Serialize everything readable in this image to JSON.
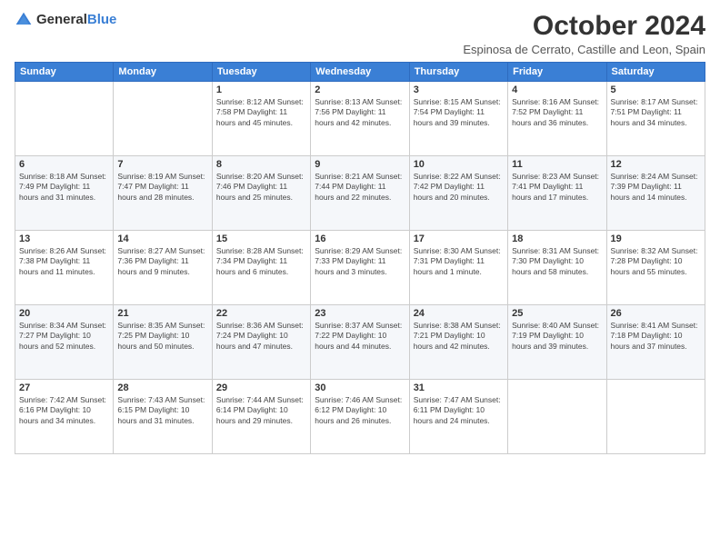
{
  "header": {
    "logo_general": "General",
    "logo_blue": "Blue",
    "title": "October 2024",
    "subtitle": "Espinosa de Cerrato, Castille and Leon, Spain"
  },
  "weekdays": [
    "Sunday",
    "Monday",
    "Tuesday",
    "Wednesday",
    "Thursday",
    "Friday",
    "Saturday"
  ],
  "weeks": [
    [
      {
        "day": "",
        "info": ""
      },
      {
        "day": "",
        "info": ""
      },
      {
        "day": "1",
        "info": "Sunrise: 8:12 AM\nSunset: 7:58 PM\nDaylight: 11 hours and 45 minutes."
      },
      {
        "day": "2",
        "info": "Sunrise: 8:13 AM\nSunset: 7:56 PM\nDaylight: 11 hours and 42 minutes."
      },
      {
        "day": "3",
        "info": "Sunrise: 8:15 AM\nSunset: 7:54 PM\nDaylight: 11 hours and 39 minutes."
      },
      {
        "day": "4",
        "info": "Sunrise: 8:16 AM\nSunset: 7:52 PM\nDaylight: 11 hours and 36 minutes."
      },
      {
        "day": "5",
        "info": "Sunrise: 8:17 AM\nSunset: 7:51 PM\nDaylight: 11 hours and 34 minutes."
      }
    ],
    [
      {
        "day": "6",
        "info": "Sunrise: 8:18 AM\nSunset: 7:49 PM\nDaylight: 11 hours and 31 minutes."
      },
      {
        "day": "7",
        "info": "Sunrise: 8:19 AM\nSunset: 7:47 PM\nDaylight: 11 hours and 28 minutes."
      },
      {
        "day": "8",
        "info": "Sunrise: 8:20 AM\nSunset: 7:46 PM\nDaylight: 11 hours and 25 minutes."
      },
      {
        "day": "9",
        "info": "Sunrise: 8:21 AM\nSunset: 7:44 PM\nDaylight: 11 hours and 22 minutes."
      },
      {
        "day": "10",
        "info": "Sunrise: 8:22 AM\nSunset: 7:42 PM\nDaylight: 11 hours and 20 minutes."
      },
      {
        "day": "11",
        "info": "Sunrise: 8:23 AM\nSunset: 7:41 PM\nDaylight: 11 hours and 17 minutes."
      },
      {
        "day": "12",
        "info": "Sunrise: 8:24 AM\nSunset: 7:39 PM\nDaylight: 11 hours and 14 minutes."
      }
    ],
    [
      {
        "day": "13",
        "info": "Sunrise: 8:26 AM\nSunset: 7:38 PM\nDaylight: 11 hours and 11 minutes."
      },
      {
        "day": "14",
        "info": "Sunrise: 8:27 AM\nSunset: 7:36 PM\nDaylight: 11 hours and 9 minutes."
      },
      {
        "day": "15",
        "info": "Sunrise: 8:28 AM\nSunset: 7:34 PM\nDaylight: 11 hours and 6 minutes."
      },
      {
        "day": "16",
        "info": "Sunrise: 8:29 AM\nSunset: 7:33 PM\nDaylight: 11 hours and 3 minutes."
      },
      {
        "day": "17",
        "info": "Sunrise: 8:30 AM\nSunset: 7:31 PM\nDaylight: 11 hours and 1 minute."
      },
      {
        "day": "18",
        "info": "Sunrise: 8:31 AM\nSunset: 7:30 PM\nDaylight: 10 hours and 58 minutes."
      },
      {
        "day": "19",
        "info": "Sunrise: 8:32 AM\nSunset: 7:28 PM\nDaylight: 10 hours and 55 minutes."
      }
    ],
    [
      {
        "day": "20",
        "info": "Sunrise: 8:34 AM\nSunset: 7:27 PM\nDaylight: 10 hours and 52 minutes."
      },
      {
        "day": "21",
        "info": "Sunrise: 8:35 AM\nSunset: 7:25 PM\nDaylight: 10 hours and 50 minutes."
      },
      {
        "day": "22",
        "info": "Sunrise: 8:36 AM\nSunset: 7:24 PM\nDaylight: 10 hours and 47 minutes."
      },
      {
        "day": "23",
        "info": "Sunrise: 8:37 AM\nSunset: 7:22 PM\nDaylight: 10 hours and 44 minutes."
      },
      {
        "day": "24",
        "info": "Sunrise: 8:38 AM\nSunset: 7:21 PM\nDaylight: 10 hours and 42 minutes."
      },
      {
        "day": "25",
        "info": "Sunrise: 8:40 AM\nSunset: 7:19 PM\nDaylight: 10 hours and 39 minutes."
      },
      {
        "day": "26",
        "info": "Sunrise: 8:41 AM\nSunset: 7:18 PM\nDaylight: 10 hours and 37 minutes."
      }
    ],
    [
      {
        "day": "27",
        "info": "Sunrise: 7:42 AM\nSunset: 6:16 PM\nDaylight: 10 hours and 34 minutes."
      },
      {
        "day": "28",
        "info": "Sunrise: 7:43 AM\nSunset: 6:15 PM\nDaylight: 10 hours and 31 minutes."
      },
      {
        "day": "29",
        "info": "Sunrise: 7:44 AM\nSunset: 6:14 PM\nDaylight: 10 hours and 29 minutes."
      },
      {
        "day": "30",
        "info": "Sunrise: 7:46 AM\nSunset: 6:12 PM\nDaylight: 10 hours and 26 minutes."
      },
      {
        "day": "31",
        "info": "Sunrise: 7:47 AM\nSunset: 6:11 PM\nDaylight: 10 hours and 24 minutes."
      },
      {
        "day": "",
        "info": ""
      },
      {
        "day": "",
        "info": ""
      }
    ]
  ]
}
